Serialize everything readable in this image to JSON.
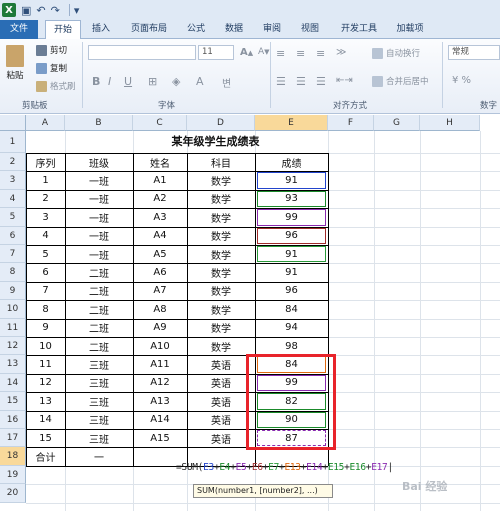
{
  "quick_access": {
    "undo_icon": "undo-icon",
    "redo_icon": "redo-icon",
    "save_icon": "save-icon"
  },
  "ribbon_tabs": [
    "文件",
    "开始",
    "插入",
    "页面布局",
    "公式",
    "数据",
    "审阅",
    "视图",
    "开发工具",
    "加载项"
  ],
  "ribbon": {
    "clipboard": {
      "paste": "粘贴",
      "cut": "剪切",
      "copy": "复制",
      "format_painter": "格式刷",
      "label": "剪贴板"
    },
    "font": {
      "size": "11",
      "bold": "B",
      "italic": "I",
      "underline": "U",
      "label": "字体"
    },
    "alignment": {
      "wrap": "自动换行",
      "merge": "合并后居中",
      "label": "对齐方式"
    },
    "number": {
      "format": "常规",
      "label": "数字"
    }
  },
  "columns": [
    "A",
    "B",
    "C",
    "D",
    "E",
    "F",
    "G",
    "H"
  ],
  "rows": [
    "1",
    "2",
    "3",
    "4",
    "5",
    "6",
    "7",
    "8",
    "9",
    "10",
    "11",
    "12",
    "13",
    "14",
    "15",
    "16",
    "17",
    "18",
    "19",
    "20"
  ],
  "sheet": {
    "title": "某年级学生成绩表",
    "headers": [
      "序列",
      "班级",
      "姓名",
      "科目",
      "成绩"
    ],
    "records": [
      [
        "1",
        "一班",
        "A1",
        "数学",
        "91"
      ],
      [
        "2",
        "一班",
        "A2",
        "数学",
        "93"
      ],
      [
        "3",
        "一班",
        "A3",
        "数学",
        "99"
      ],
      [
        "4",
        "一班",
        "A4",
        "数学",
        "96"
      ],
      [
        "5",
        "一班",
        "A5",
        "数学",
        "91"
      ],
      [
        "6",
        "二班",
        "A6",
        "数学",
        "91"
      ],
      [
        "7",
        "二班",
        "A7",
        "数学",
        "96"
      ],
      [
        "8",
        "二班",
        "A8",
        "数学",
        "84"
      ],
      [
        "9",
        "二班",
        "A9",
        "数学",
        "94"
      ],
      [
        "10",
        "二班",
        "A10",
        "数学",
        "98"
      ],
      [
        "11",
        "三班",
        "A11",
        "英语",
        "84"
      ],
      [
        "12",
        "三班",
        "A12",
        "英语",
        "99"
      ],
      [
        "13",
        "三班",
        "A13",
        "英语",
        "82"
      ],
      [
        "14",
        "三班",
        "A14",
        "英语",
        "90"
      ],
      [
        "15",
        "三班",
        "A15",
        "英语",
        "87"
      ]
    ],
    "total_label": "合计",
    "total_dash": "一"
  },
  "formula": {
    "prefix": "=SUM(",
    "refs": [
      "E3",
      "E4",
      "E5",
      "E6",
      "E7",
      "E13",
      "E14",
      "E15",
      "E16",
      "E17"
    ],
    "ref_colors": [
      "#2244cc",
      "#1a8a2a",
      "#8a2bb0",
      "#a02a2a",
      "#2a9a3a",
      "#e06a10",
      "#8a2bb0",
      "#1a8a2a",
      "#1a8a2a",
      "#8a2bb0"
    ],
    "separator": "+",
    "suffix": "|"
  },
  "tooltip": "SUM(number1, [number2], ...)",
  "watermark": "Bai 经验"
}
